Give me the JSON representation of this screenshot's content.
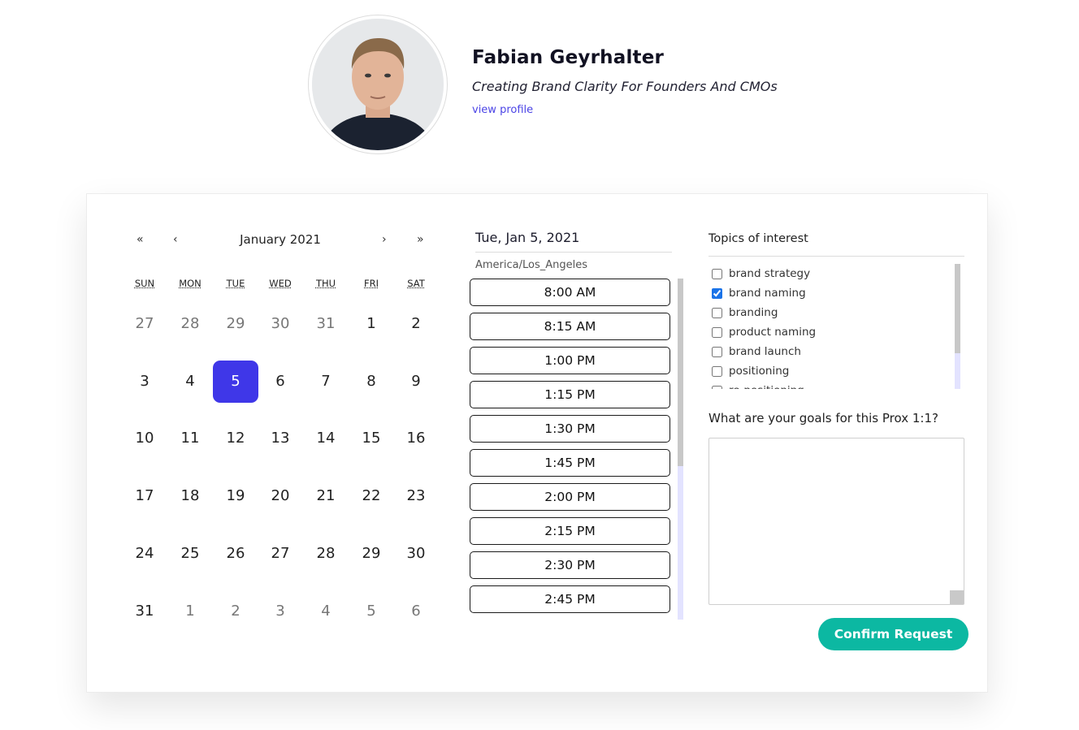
{
  "profile": {
    "name": "Fabian Geyrhalter",
    "tagline": "Creating Brand Clarity For Founders And CMOs",
    "link_label": "view profile"
  },
  "calendar": {
    "month_label": "January 2021",
    "nav": {
      "prev_year": "«",
      "prev_month": "‹",
      "next_month": "›",
      "next_year": "»"
    },
    "weekdays": [
      "SUN",
      "MON",
      "TUE",
      "WED",
      "THU",
      "FRI",
      "SAT"
    ],
    "weeks": [
      [
        {
          "d": "27",
          "m": true
        },
        {
          "d": "28",
          "m": true
        },
        {
          "d": "29",
          "m": true
        },
        {
          "d": "30",
          "m": true
        },
        {
          "d": "31",
          "m": true
        },
        {
          "d": "1"
        },
        {
          "d": "2"
        }
      ],
      [
        {
          "d": "3"
        },
        {
          "d": "4"
        },
        {
          "d": "5",
          "s": true
        },
        {
          "d": "6"
        },
        {
          "d": "7"
        },
        {
          "d": "8"
        },
        {
          "d": "9"
        }
      ],
      [
        {
          "d": "10"
        },
        {
          "d": "11"
        },
        {
          "d": "12"
        },
        {
          "d": "13"
        },
        {
          "d": "14"
        },
        {
          "d": "15"
        },
        {
          "d": "16"
        }
      ],
      [
        {
          "d": "17"
        },
        {
          "d": "18"
        },
        {
          "d": "19"
        },
        {
          "d": "20"
        },
        {
          "d": "21"
        },
        {
          "d": "22"
        },
        {
          "d": "23"
        }
      ],
      [
        {
          "d": "24"
        },
        {
          "d": "25"
        },
        {
          "d": "26"
        },
        {
          "d": "27"
        },
        {
          "d": "28"
        },
        {
          "d": "29"
        },
        {
          "d": "30"
        }
      ],
      [
        {
          "d": "31"
        },
        {
          "d": "1",
          "m": true
        },
        {
          "d": "2",
          "m": true
        },
        {
          "d": "3",
          "m": true
        },
        {
          "d": "4",
          "m": true
        },
        {
          "d": "5",
          "m": true
        },
        {
          "d": "6",
          "m": true
        }
      ]
    ],
    "selected_color": "#3f37e8"
  },
  "times": {
    "date_label": "Tue, Jan 5, 2021",
    "timezone": "America/Los_Angeles",
    "slots": [
      "8:00 AM",
      "8:15 AM",
      "1:00 PM",
      "1:15 PM",
      "1:30 PM",
      "1:45 PM",
      "2:00 PM",
      "2:15 PM",
      "2:30 PM",
      "2:45 PM"
    ]
  },
  "topics": {
    "title": "Topics of interest",
    "items": [
      {
        "label": "brand strategy",
        "checked": false
      },
      {
        "label": "brand naming",
        "checked": true
      },
      {
        "label": "branding",
        "checked": false
      },
      {
        "label": "product naming",
        "checked": false
      },
      {
        "label": "brand launch",
        "checked": false
      },
      {
        "label": "positioning",
        "checked": false
      },
      {
        "label": "re-positioning",
        "checked": false
      }
    ]
  },
  "goals": {
    "label": "What are your goals for this Prox 1:1?",
    "value": ""
  },
  "confirm": {
    "label": "Confirm Request",
    "color": "#0cb8a2"
  }
}
